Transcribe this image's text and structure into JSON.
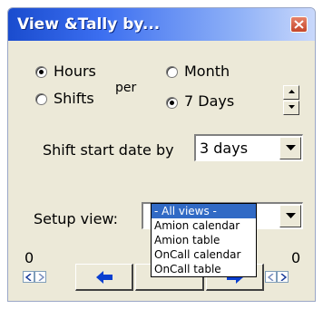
{
  "window": {
    "title": "View &Tally by...",
    "colors": {
      "titlebar": "#1a4cce",
      "close": "#c4462a",
      "face": "#ece9d8",
      "highlight": "#316ac5",
      "arrow": "#0a3fd0"
    }
  },
  "units": {
    "hours_label": "Hours",
    "shifts_label": "Shifts",
    "per_label": "per",
    "selected": "Hours"
  },
  "period": {
    "month_label": "Month",
    "days_label": "7 Days",
    "selected": "7 Days"
  },
  "shift_start": {
    "label": "Shift start date by",
    "value": "3 days"
  },
  "setup_view": {
    "label": "Setup view:",
    "options": [
      "- All views -",
      "Amion calendar",
      "Amion table",
      "OnCall calendar",
      "OnCall table"
    ],
    "highlighted": "- All views -"
  },
  "nav": {
    "left_count": "0",
    "right_count": "0",
    "icons": [
      "left-arrow-icon",
      "right-arrow-icon"
    ]
  }
}
